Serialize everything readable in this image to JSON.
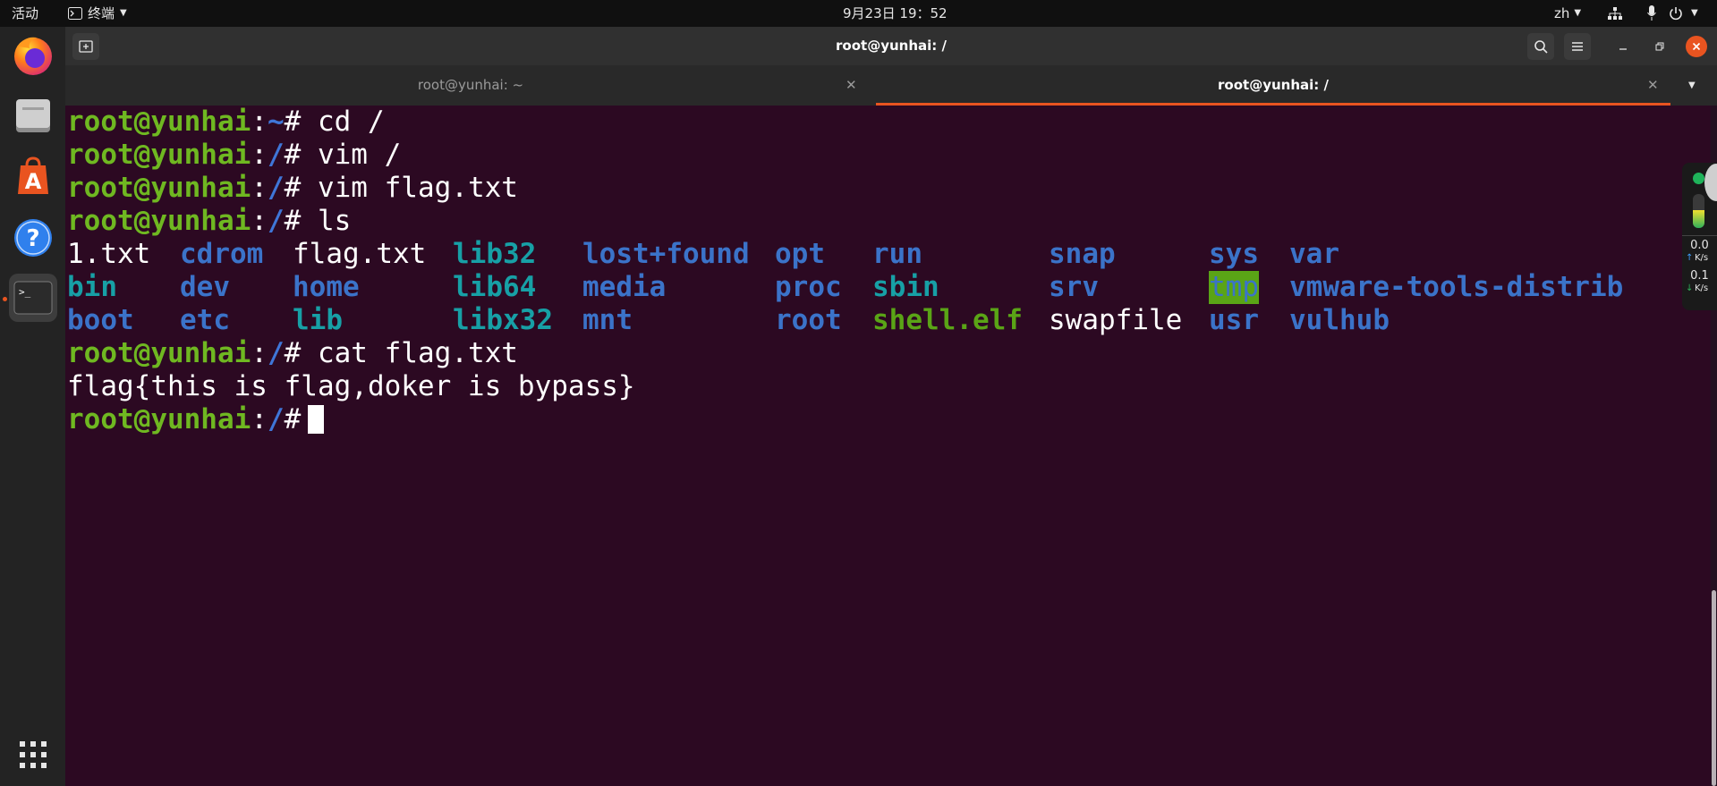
{
  "topbar": {
    "activities": "活动",
    "app_menu": "终端",
    "clock": "9月23日  19：52",
    "lang": "zh"
  },
  "dock": {
    "apps": [
      {
        "name": "firefox-icon"
      },
      {
        "name": "files-icon"
      },
      {
        "name": "software-icon"
      },
      {
        "name": "help-icon"
      },
      {
        "name": "terminal-icon"
      }
    ]
  },
  "window": {
    "title": "root@yunhai: /",
    "tabs": [
      {
        "label": "root@yunhai: ~",
        "active": false
      },
      {
        "label": "root@yunhai: /",
        "active": true
      }
    ]
  },
  "netmon": {
    "up": "0.0",
    "up_unit": "K/s",
    "down": "0.1",
    "down_unit": "K/s"
  },
  "terminal": {
    "prompt_user": "root@yunhai",
    "lines": [
      {
        "user": "root@yunhai",
        "sep": ":",
        "path": "~",
        "hash": "# ",
        "cmd": "cd /"
      },
      {
        "user": "root@yunhai",
        "sep": ":",
        "path": "/",
        "hash": "# ",
        "cmd": "vim /"
      },
      {
        "user": "root@yunhai",
        "sep": ":",
        "path": "/",
        "hash": "# ",
        "cmd": "vim flag.txt"
      },
      {
        "user": "root@yunhai",
        "sep": ":",
        "path": "/",
        "hash": "# ",
        "cmd": "ls"
      }
    ],
    "ls_items": [
      [
        "1.txt",
        "cdrom",
        "flag.txt",
        "lib32",
        "lost+found",
        "opt",
        "run",
        "snap",
        "sys",
        "var"
      ],
      [
        "bin",
        "dev",
        "home",
        "lib64",
        "media",
        "proc",
        "sbin",
        "srv",
        "tmp",
        "vmware-tools-distrib"
      ],
      [
        "boot",
        "etc",
        "lib",
        "libx32",
        "mnt",
        "root",
        "shell.elf",
        "swapfile",
        "usr",
        "vulhub"
      ]
    ],
    "ls_types": [
      [
        "file",
        "dir",
        "file",
        "link",
        "dir",
        "dir",
        "dir",
        "dir",
        "dir",
        "dir"
      ],
      [
        "link",
        "dir",
        "dir",
        "link",
        "dir",
        "dir",
        "link",
        "dir",
        "tmp",
        "dir"
      ],
      [
        "dir",
        "dir",
        "link",
        "link",
        "dir",
        "dir",
        "exec",
        "file",
        "dir",
        "dir"
      ]
    ],
    "cat_line": {
      "user": "root@yunhai",
      "sep": ":",
      "path": "/",
      "hash": "# ",
      "cmd": "cat flag.txt"
    },
    "output": "flag{this is flag,doker is bypass}",
    "last_prompt": {
      "user": "root@yunhai",
      "sep": ":",
      "path": "/",
      "hash": "# "
    }
  },
  "colors": {
    "terminal_bg": "#2c0922",
    "user": "#6fb821",
    "path": "#3f76d8",
    "accent_tab": "#e95420",
    "close_button": "#e95420"
  }
}
